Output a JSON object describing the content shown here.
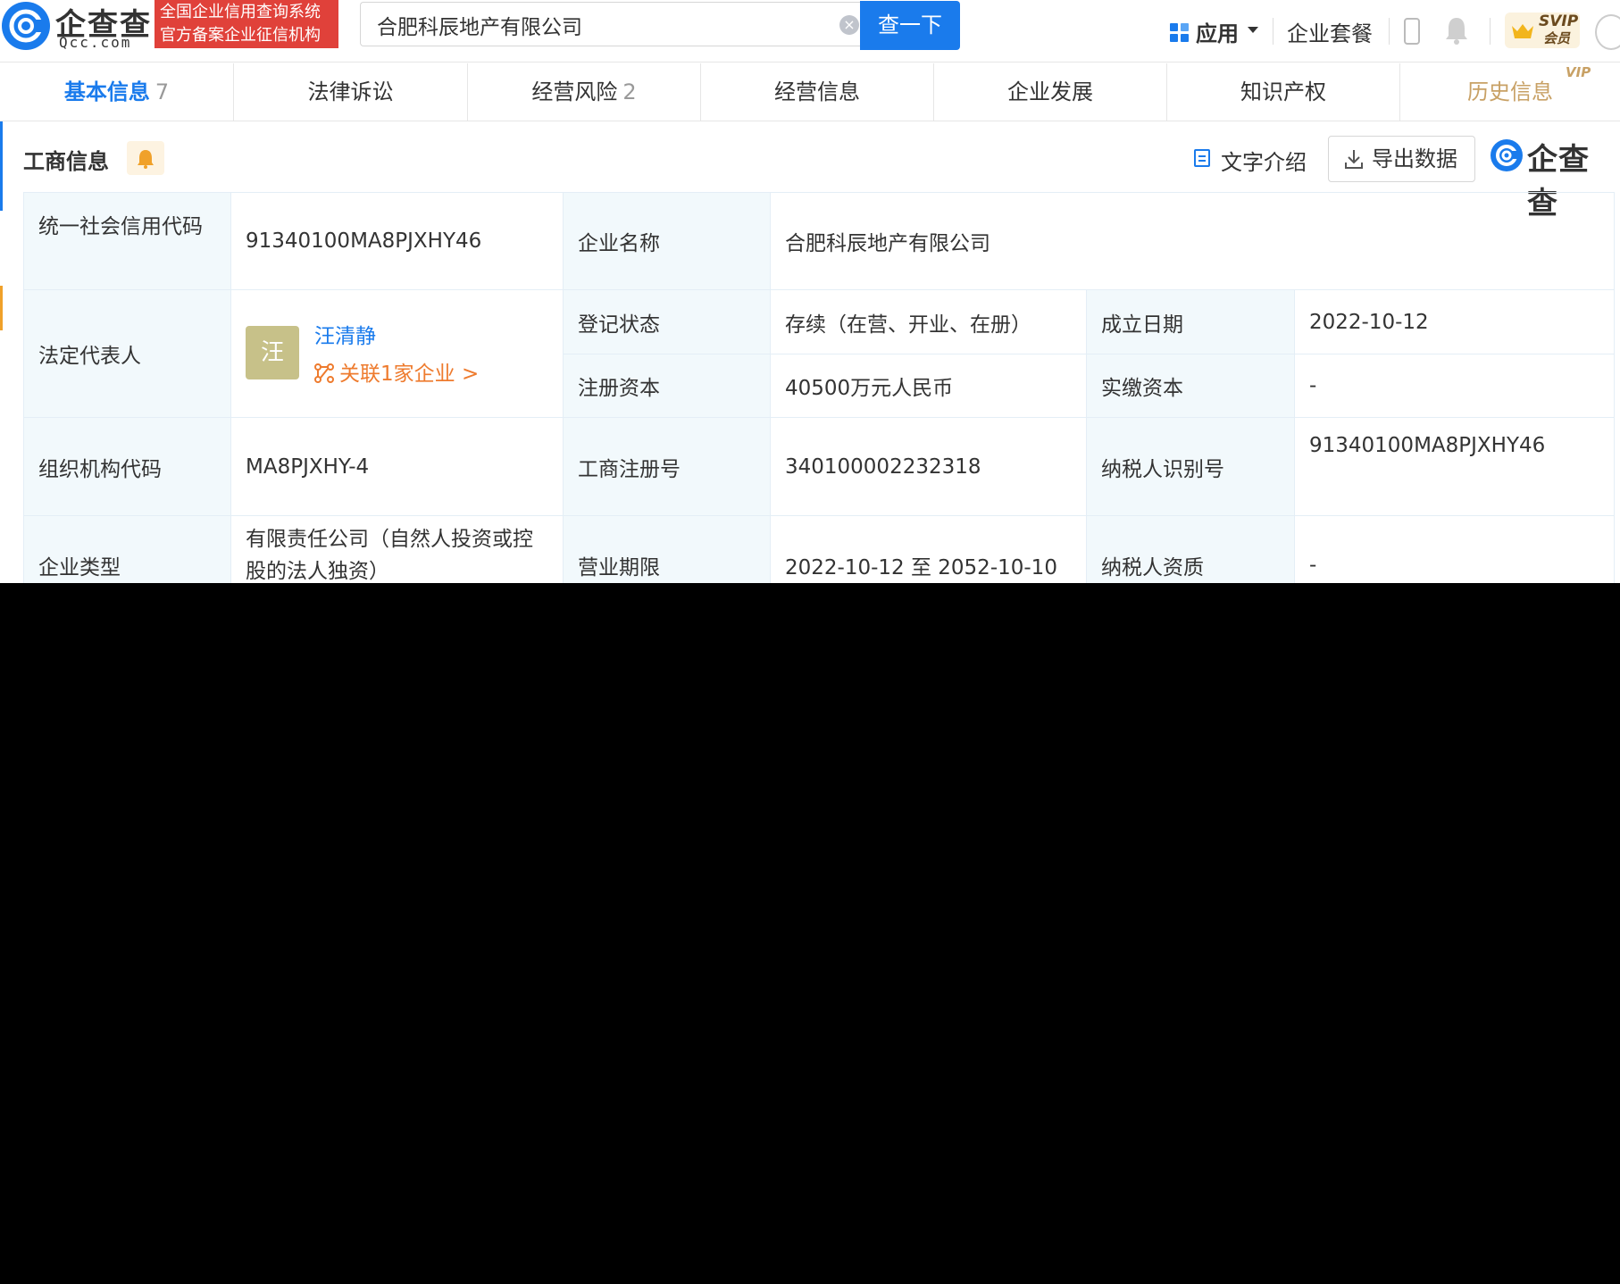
{
  "header": {
    "logo_name": "企查查",
    "logo_domain": "Qcc.com",
    "badge_line1": "全国企业信用查询系统",
    "badge_line2": "官方备案企业征信机构",
    "search_value": "合肥科辰地产有限公司",
    "search_button": "查一下",
    "apps_label": "应用",
    "plan_label": "企业套餐",
    "svip_label": "SVIP",
    "svip_sub": "会员"
  },
  "tabs": [
    {
      "label": "基本信息",
      "count": "7"
    },
    {
      "label": "法律诉讼",
      "count": ""
    },
    {
      "label": "经营风险",
      "count": "2"
    },
    {
      "label": "经营信息",
      "count": ""
    },
    {
      "label": "企业发展",
      "count": ""
    },
    {
      "label": "知识产权",
      "count": ""
    },
    {
      "label": "历史信息",
      "count": "",
      "vip": "VIP"
    }
  ],
  "section": {
    "title": "工商信息",
    "text_intro": "文字介绍",
    "export_label": "导出数据",
    "brand_word": "企查查"
  },
  "info": {
    "credit_code_label": "统一社会信用代码",
    "credit_code": "91340100MA8PJXHY46",
    "company_name_label": "企业名称",
    "company_name": "合肥科辰地产有限公司",
    "legal_rep_label": "法定代表人",
    "legal_rep_avatar": "汪",
    "legal_rep_name": "汪清静",
    "legal_rep_related": "关联1家企业 >",
    "status_label": "登记状态",
    "status": "存续（在营、开业、在册）",
    "founded_label": "成立日期",
    "founded": "2022-10-12",
    "reg_capital_label": "注册资本",
    "reg_capital": "40500万元人民币",
    "paid_capital_label": "实缴资本",
    "paid_capital": "-",
    "org_code_label": "组织机构代码",
    "org_code": "MA8PJXHY-4",
    "biz_reg_no_label": "工商注册号",
    "biz_reg_no": "340100002232318",
    "taxpayer_id_label": "纳税人识别号",
    "taxpayer_id": "91340100MA8PJXHY46",
    "company_type_label": "企业类型",
    "company_type": "有限责任公司（自然人投资或控股的法人独资）",
    "biz_term_label": "营业期限",
    "biz_term": "2022-10-12 至 2052-10-10",
    "taxpayer_qual_label": "纳税人资质",
    "taxpayer_qual": "-"
  },
  "colors": {
    "brand_blue": "#1a7bec",
    "badge_red": "#e0413a",
    "link_orange": "#ee7b2e",
    "label_bg": "#f2f9fc",
    "vip_gold": "#c8a165"
  }
}
